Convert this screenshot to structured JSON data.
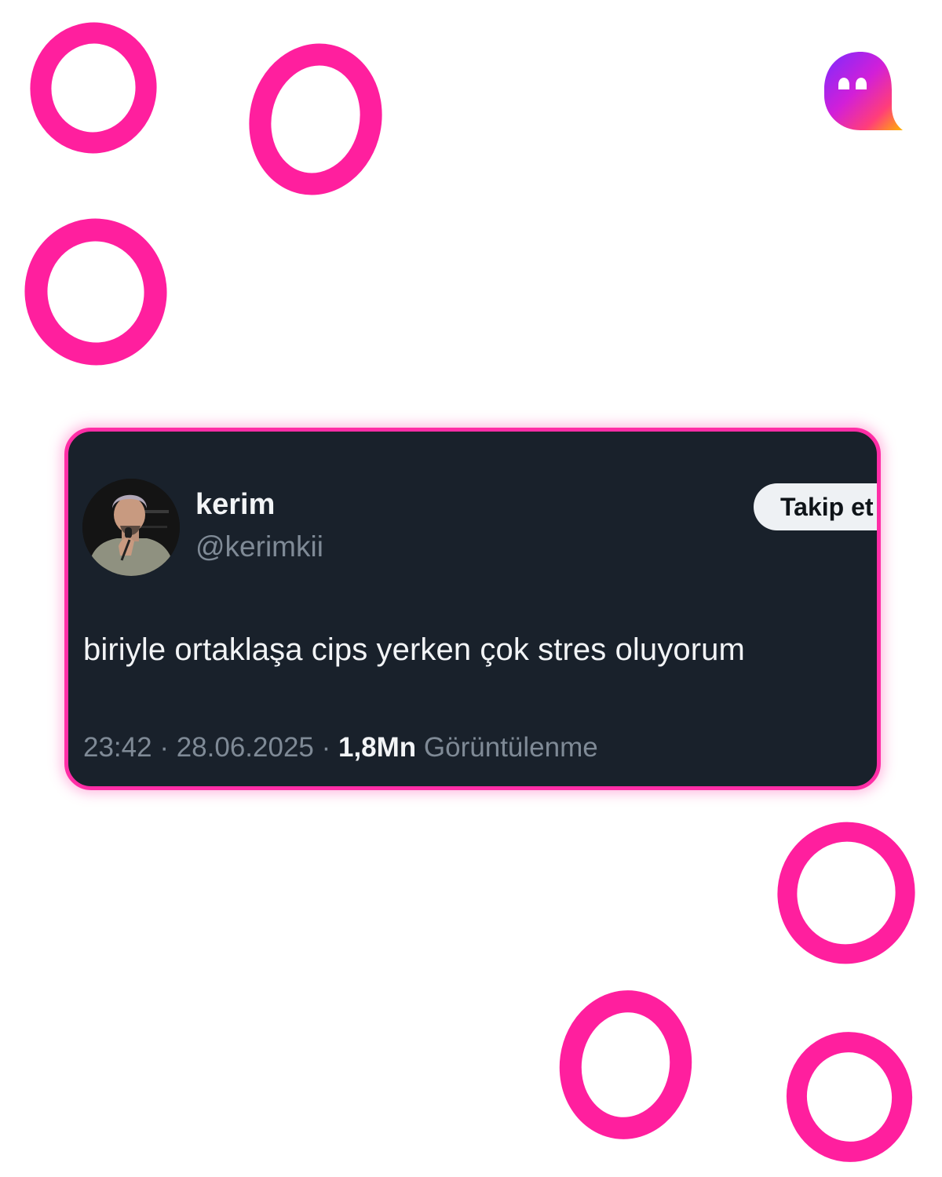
{
  "tweet": {
    "author_name": "kerim",
    "author_handle": "@kerimkii",
    "follow_label": "Takip et",
    "text": "biriyle ortaklaşa cips yerken çok stres oluyorum",
    "time": "23:42",
    "date": "28.06.2025",
    "separator": " · ",
    "views_count": "1,8Mn",
    "views_label": "Görüntülenme"
  },
  "colors": {
    "accent_pink": "#ff1f9e",
    "card_background": "#19212b",
    "card_border": "#ff2ea6",
    "primary_text": "#f2f4f6",
    "secondary_text": "#7f8a96",
    "follow_button": "#eef1f4"
  },
  "icons": {
    "brand": "ghost-logo-icon",
    "decoration": "hand-drawn-circle"
  }
}
